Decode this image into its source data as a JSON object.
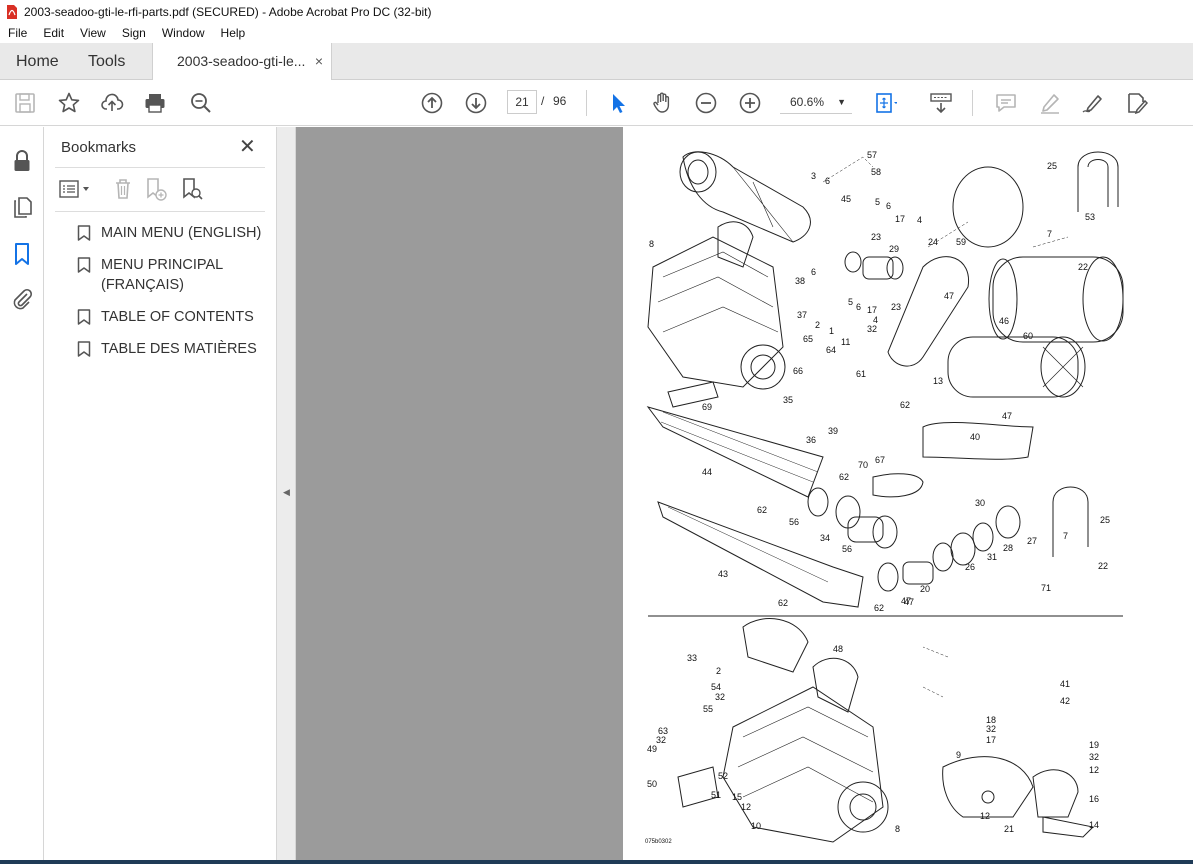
{
  "window": {
    "title": "2003-seadoo-gti-le-rfi-parts.pdf (SECURED) - Adobe Acrobat Pro DC (32-bit)"
  },
  "menu": [
    "File",
    "Edit",
    "View",
    "Sign",
    "Window",
    "Help"
  ],
  "tabs": {
    "home": "Home",
    "tools": "Tools",
    "document": "2003-seadoo-gti-le...",
    "close": "×"
  },
  "toolbar": {
    "current_page": "21",
    "page_separator": "/",
    "total_pages": "96",
    "zoom": "60.6%"
  },
  "bookmarks": {
    "title": "Bookmarks",
    "items": [
      {
        "label": "MAIN MENU (ENGLISH)"
      },
      {
        "label": "MENU PRINCIPAL (FRANÇAIS)"
      },
      {
        "label": "TABLE OF CONTENTS"
      },
      {
        "label": "TABLE DES MATIÈRES"
      }
    ]
  },
  "diagram": {
    "labels_top": [
      "57",
      "58",
      "3",
      "6",
      "45",
      "5",
      "6",
      "17",
      "4",
      "25",
      "53",
      "7",
      "22",
      "8",
      "23",
      "29",
      "24",
      "59",
      "38",
      "6",
      "5",
      "6",
      "17",
      "4",
      "23",
      "37",
      "2",
      "1",
      "32",
      "47",
      "46",
      "60",
      "11",
      "65",
      "64",
      "66",
      "61",
      "13",
      "69",
      "35",
      "62",
      "39",
      "36",
      "67",
      "47",
      "40",
      "44",
      "70",
      "62",
      "62",
      "56",
      "34",
      "56",
      "30",
      "27",
      "28",
      "31",
      "26",
      "25",
      "7",
      "22",
      "43",
      "47",
      "20",
      "62",
      "62",
      "47",
      "71"
    ],
    "labels_bottom": [
      "48",
      "33",
      "2",
      "54",
      "32",
      "55",
      "63",
      "32",
      "49",
      "52",
      "50",
      "51",
      "15",
      "12",
      "10",
      "8",
      "41",
      "42",
      "18",
      "32",
      "17",
      "9",
      "19",
      "32",
      "12",
      "16",
      "12",
      "21",
      "14"
    ],
    "figure_code": "075b0302"
  },
  "colors": {
    "accent": "#1473e6",
    "tabbar": "#e9e9e9",
    "doc_bg": "#9b9b9b"
  }
}
